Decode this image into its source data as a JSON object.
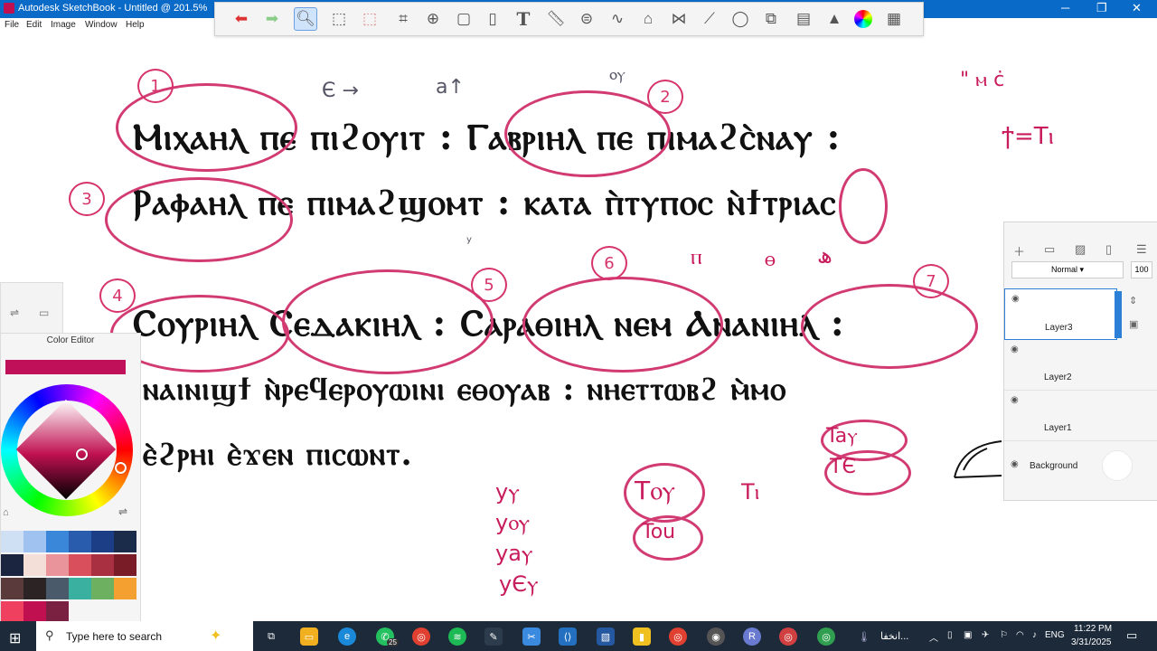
{
  "window": {
    "title": "Autodesk SketchBook - Untitled @ 201.5%",
    "minimize": "─",
    "maximize": "❐",
    "close": "✕"
  },
  "menu": [
    "File",
    "Edit",
    "Image",
    "Window",
    "Help"
  ],
  "canvas": {
    "coptic_lines": [
      "Ⲙⲓⲭⲁⲏⲗ ⲡⲉ ⲡⲓϩⲟⲩⲓⲧ : Ⲅⲁⲃⲣⲓⲏⲗ ⲡⲉ ⲡⲓⲙⲁϩⲥ̀ⲛⲁⲩ :",
      "Ⲣⲁⲫⲁⲏⲗ ⲡⲉ ⲡⲓⲙⲁϩϣⲟⲙⲧ : ⲕⲁⲧⲁ ⲡ̀ⲧⲩⲡⲟⲥ ⲛ̀ϯⲧⲣⲓⲁⲥ",
      "Ⲥⲟⲩⲣⲓⲏⲗ Ⲥⲉⲇⲁⲕⲓⲏⲗ : Ⲥⲁⲣⲁⲑⲓⲏⲗ ⲛⲉⲙ Ⲁⲛⲁⲛⲓⲏⲗ :",
      "ⲛⲁⲓⲛⲓϣϯ ⲛ̀ⲣⲉϥⲉⲣⲟⲩⲱⲓⲛⲓ ⲉⲑⲟⲩⲁⲃ : ⲛⲏⲉⲧⲧⲱⲃϩ ⲙ̀ⲙⲟ",
      "ⲉ̀ϩⲣⲏⲓ ⲉ̀ϫⲉⲛ ⲡⲓⲥⲱⲛⲧ."
    ],
    "circle_numbers": [
      "1",
      "2",
      "3",
      "4",
      "5",
      "6",
      "7"
    ],
    "annotations": {
      "e_arrow": "Є →",
      "a_arrow": "a↑",
      "ou": "ⲟⲩ",
      "gray_u": "ʸ",
      "pi": "ⲡ",
      "theta": "ⲑ",
      "hei": "ھ",
      "top_right": "\" ⲙ ċ",
      "ti": "ϯ=Tⲓ",
      "tay": "Taⲩ",
      "te": "TЄ",
      "tou": "Tⲟⲩ",
      "tou2": "Tou",
      "ti2": "Tⲓ",
      "yu_list": [
        "yⲩ",
        "yⲟⲩ",
        "yaⲩ",
        "yЄⲩ"
      ]
    }
  },
  "color_editor": {
    "title": "Color Editor",
    "current_color": "#c0105a",
    "palette": [
      "#cfe0f5",
      "#9fc2f0",
      "#3a86d8",
      "#2a5cad",
      "#1c3e86",
      "#1b2c4a",
      "#1b2540",
      "#f3ded8",
      "#e8949a",
      "#d9505c",
      "#a83040",
      "#7a1c28",
      "#5a3a3a",
      "#2c2424",
      "#4a5a6a",
      "#3ab0a0",
      "#6cb060",
      "#f4a030",
      "#f04060",
      "#c01050",
      "#7a2040"
    ]
  },
  "layers": {
    "blend_mode": "Normal",
    "opacity": "100",
    "items": [
      {
        "name": "Layer3"
      },
      {
        "name": "Layer2"
      },
      {
        "name": "Layer1"
      },
      {
        "name": "Background"
      }
    ]
  },
  "taskbar": {
    "search_placeholder": "Type here to search",
    "app_badge": "25",
    "weather_text": "انخفا...",
    "lang": "ENG",
    "time": "11:22 PM",
    "date": "3/31/2025"
  }
}
